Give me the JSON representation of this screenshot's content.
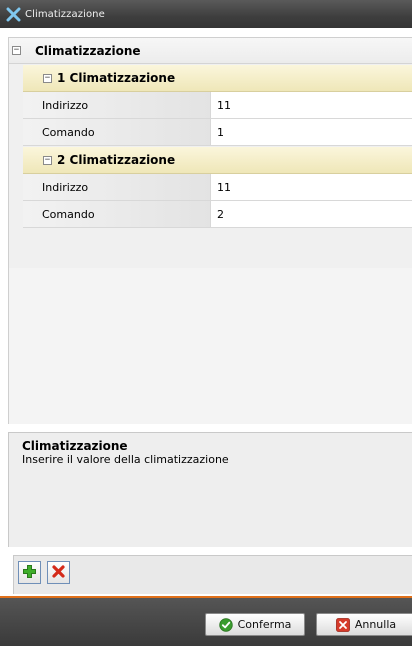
{
  "window": {
    "title": "Climatizzazione"
  },
  "grid": {
    "root_label": "Climatizzazione",
    "categories": [
      {
        "label": "1 Climatizzazione",
        "properties": [
          {
            "name": "Indirizzo",
            "value": "11"
          },
          {
            "name": "Comando",
            "value": "1"
          }
        ]
      },
      {
        "label": "2 Climatizzazione",
        "properties": [
          {
            "name": "Indirizzo",
            "value": "11"
          },
          {
            "name": "Comando",
            "value": "2"
          }
        ]
      }
    ]
  },
  "description": {
    "title": "Climatizzazione",
    "text": "Inserire il valore della climatizzazione"
  },
  "toolbar": {
    "add_icon": "plus-icon",
    "remove_icon": "x-icon"
  },
  "footer": {
    "confirm_label": "Conferma",
    "cancel_label": "Annulla"
  },
  "colors": {
    "accent": "#e0701a",
    "category_bg": "#f3edc8",
    "titlebar": "#444444"
  }
}
